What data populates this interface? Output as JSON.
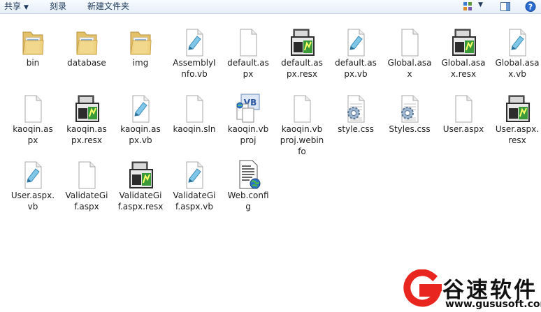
{
  "toolbar": {
    "share": "共享",
    "burn": "刻录",
    "new_folder": "新建文件夹"
  },
  "files": [
    {
      "label": "bin",
      "type": "folder",
      "icon": "folder-icon"
    },
    {
      "label": "database",
      "type": "folder",
      "icon": "folder-icon"
    },
    {
      "label": "img",
      "type": "folder",
      "icon": "folder-icon"
    },
    {
      "label": "AssemblyI\nnfo.vb",
      "type": "vb",
      "icon": "vb-file-icon"
    },
    {
      "label": "default.as\npx",
      "type": "blank",
      "icon": "blank-file-icon"
    },
    {
      "label": "default.as\npx.resx",
      "type": "resx",
      "icon": "resx-file-icon"
    },
    {
      "label": "default.as\npx.vb",
      "type": "vb",
      "icon": "vb-file-icon"
    },
    {
      "label": "Global.asa\nx",
      "type": "blank",
      "icon": "blank-file-icon"
    },
    {
      "label": "Global.asa\nx.resx",
      "type": "resx",
      "icon": "resx-file-icon"
    },
    {
      "label": "Global.asa\nx.vb",
      "type": "vb",
      "icon": "vb-file-icon"
    },
    {
      "label": "kaoqin.as\npx",
      "type": "blank",
      "icon": "blank-file-icon"
    },
    {
      "label": "kaoqin.as\npx.resx",
      "type": "resx",
      "icon": "resx-file-icon"
    },
    {
      "label": "kaoqin.as\npx.vb",
      "type": "vb",
      "icon": "vb-file-icon"
    },
    {
      "label": "kaoqin.sln",
      "type": "blank",
      "icon": "blank-file-icon"
    },
    {
      "label": "kaoqin.vb\nproj",
      "type": "vbproj",
      "icon": "vbproj-file-icon"
    },
    {
      "label": "kaoqin.vb\nproj.webin\nfo",
      "type": "blank",
      "icon": "blank-file-icon"
    },
    {
      "label": "style.css",
      "type": "css",
      "icon": "css-file-icon"
    },
    {
      "label": "Styles.css",
      "type": "css",
      "icon": "css-file-icon"
    },
    {
      "label": "User.aspx",
      "type": "blank",
      "icon": "blank-file-icon"
    },
    {
      "label": "User.aspx.\nresx",
      "type": "resx",
      "icon": "resx-file-icon"
    },
    {
      "label": "User.aspx.\nvb",
      "type": "vb",
      "icon": "vb-file-icon"
    },
    {
      "label": "ValidateGi\nf.aspx",
      "type": "blank",
      "icon": "blank-file-icon"
    },
    {
      "label": "ValidateGi\nf.aspx.resx",
      "type": "resx",
      "icon": "resx-file-icon"
    },
    {
      "label": "ValidateGi\nf.aspx.vb",
      "type": "vb",
      "icon": "vb-file-icon"
    },
    {
      "label": "Web.confi\ng",
      "type": "config",
      "icon": "config-file-icon"
    }
  ],
  "watermark": {
    "title": "谷速软件",
    "url": "www.gususoft.com"
  }
}
